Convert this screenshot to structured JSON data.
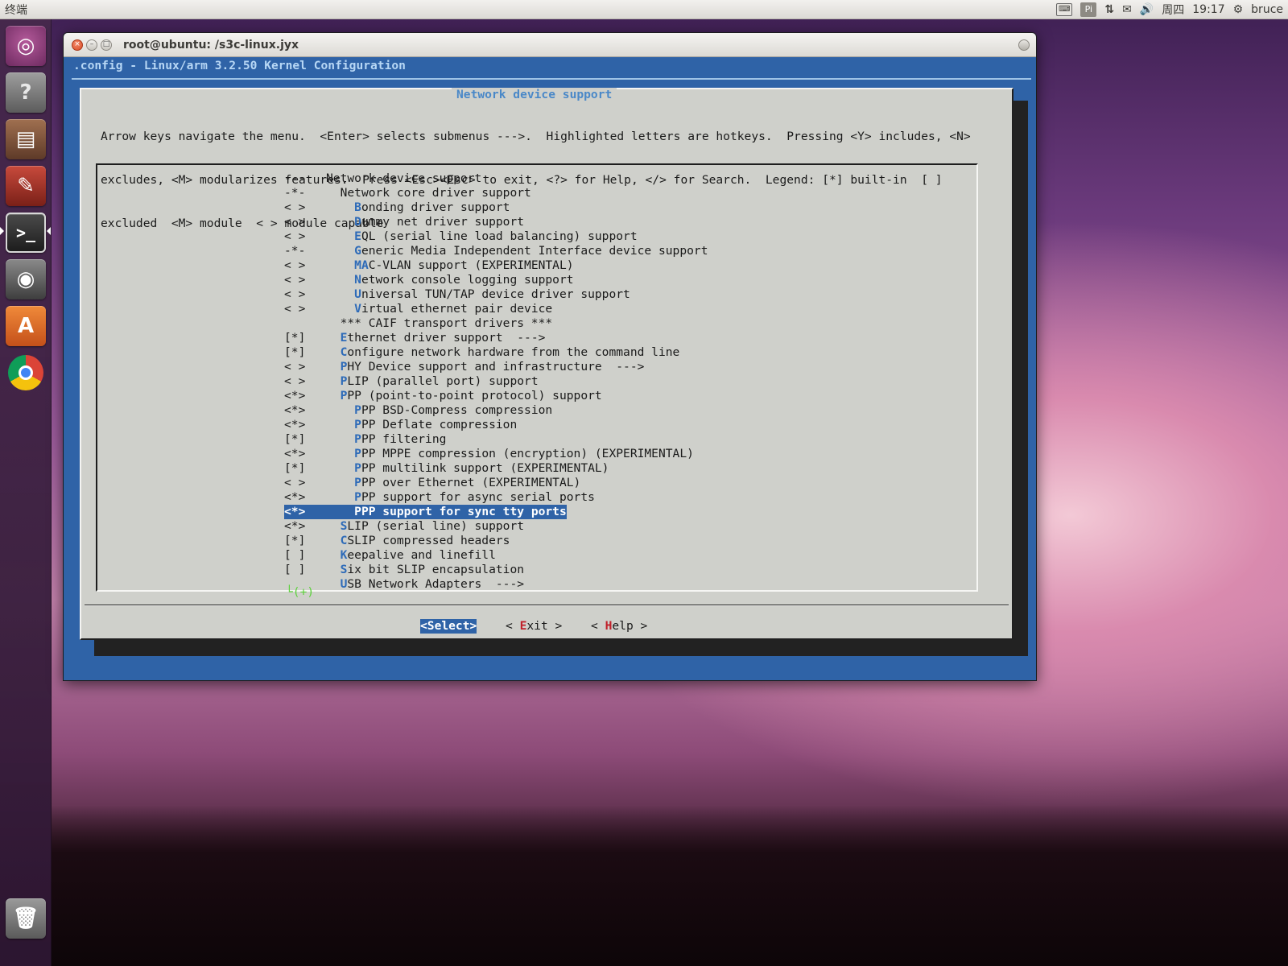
{
  "top_panel": {
    "app_name": "终端",
    "indicators": {
      "keyboard_icon": "keyboard-icon",
      "input_method": "Pi",
      "network_icon": "network-arrows-icon",
      "mail_icon": "mail-icon",
      "volume_glyph": "🔊)",
      "day": "周四",
      "time": "19:17",
      "user": "bruce"
    }
  },
  "launcher": {
    "items": [
      "ubuntu-dash",
      "help",
      "file-manager",
      "system-settings",
      "terminal",
      "camera",
      "software-center",
      "chrome",
      "trash"
    ]
  },
  "window": {
    "title": "root@ubuntu: /s3c-linux.jyx",
    "kconfig_title": ".config - Linux/arm 3.2.50 Kernel Configuration",
    "dialog": {
      "title": "Network device support",
      "help_lines": [
        "Arrow keys navigate the menu.  <Enter> selects submenus --->.  Highlighted letters are hotkeys.  Pressing <Y> includes, <N>",
        "excludes, <M> modularizes features.  Press <Esc><Esc> to exit, <?> for Help, </> for Search.  Legend: [*] built-in  [ ]",
        "excluded  <M> module  < > module capable"
      ],
      "menu": [
        {
          "state": "---",
          "indent": "",
          "hotkey": "",
          "rest": "Network device support"
        },
        {
          "state": "-*-",
          "indent": "  ",
          "hotkey": "N",
          "rest": "etwork core driver support",
          "hk_offset": 1
        },
        {
          "state": "< >",
          "indent": "    ",
          "hotkey": "B",
          "rest": "onding driver support"
        },
        {
          "state": "< >",
          "indent": "    ",
          "hotkey": "D",
          "rest": "ummy net driver support"
        },
        {
          "state": "< >",
          "indent": "    ",
          "hotkey": "E",
          "rest": "QL (serial line load balancing) support"
        },
        {
          "state": "-*-",
          "indent": "    ",
          "hotkey": "G",
          "rest": "eneric Media Independent Interface device support"
        },
        {
          "state": "< >",
          "indent": "    ",
          "hotkey": "MA",
          "rest": "C-VLAN support (EXPERIMENTAL)"
        },
        {
          "state": "< >",
          "indent": "    ",
          "hotkey": "N",
          "rest": "etwork console logging support"
        },
        {
          "state": "< >",
          "indent": "    ",
          "hotkey": "U",
          "rest": "niversal TUN/TAP device driver support"
        },
        {
          "state": "< >",
          "indent": "    ",
          "hotkey": "V",
          "rest": "irtual ethernet pair device"
        },
        {
          "state": "   ",
          "indent": "  ",
          "hotkey": "",
          "rest": "*** CAIF transport drivers ***"
        },
        {
          "state": "[*]",
          "indent": "  ",
          "hotkey": "E",
          "rest": "thernet driver support  --->"
        },
        {
          "state": "[*]",
          "indent": "  ",
          "hotkey": "C",
          "rest": "onfigure network hardware from the command line"
        },
        {
          "state": "< >",
          "indent": "  ",
          "hotkey": "P",
          "rest": "HY Device support and infrastructure  --->"
        },
        {
          "state": "< >",
          "indent": "  ",
          "hotkey": "P",
          "rest": "LIP (parallel port) support"
        },
        {
          "state": "<*>",
          "indent": "  ",
          "hotkey": "P",
          "rest": "PP (point-to-point protocol) support"
        },
        {
          "state": "<*>",
          "indent": "    ",
          "hotkey": "P",
          "rest": "PP BSD-Compress compression"
        },
        {
          "state": "<*>",
          "indent": "    ",
          "hotkey": "P",
          "rest": "PP Deflate compression"
        },
        {
          "state": "[*]",
          "indent": "    ",
          "hotkey": "P",
          "rest": "PP filtering"
        },
        {
          "state": "<*>",
          "indent": "    ",
          "hotkey": "P",
          "rest": "PP MPPE compression (encryption) (EXPERIMENTAL)"
        },
        {
          "state": "[*]",
          "indent": "    ",
          "hotkey": "P",
          "rest": "PP multilink support (EXPERIMENTAL)"
        },
        {
          "state": "< >",
          "indent": "    ",
          "hotkey": "P",
          "rest": "PP over Ethernet (EXPERIMENTAL)"
        },
        {
          "state": "<*>",
          "indent": "    ",
          "hotkey": "P",
          "rest": "PP support for async serial ports"
        },
        {
          "state": "<*>",
          "indent": "    ",
          "hotkey": "P",
          "rest": "PP support for sync tty ports",
          "selected": true
        },
        {
          "state": "<*>",
          "indent": "  ",
          "hotkey": "S",
          "rest": "LIP (serial line) support"
        },
        {
          "state": "[*]",
          "indent": "  ",
          "hotkey": "C",
          "rest": "SLIP compressed headers"
        },
        {
          "state": "[ ]",
          "indent": "  ",
          "hotkey": "K",
          "rest": "eepalive and linefill"
        },
        {
          "state": "[ ]",
          "indent": "  ",
          "hotkey": "S",
          "rest": "ix bit SLIP encapsulation"
        },
        {
          "state": "   ",
          "indent": "  ",
          "hotkey": "U",
          "rest": "SB Network Adapters  --->"
        }
      ],
      "more_indicator": "└(+)",
      "buttons": {
        "select": "<Select>",
        "exit_pre": "< ",
        "exit_hot": "E",
        "exit_rest": "xit >",
        "help_pre": "< ",
        "help_hot": "H",
        "help_rest": "elp >"
      }
    }
  },
  "colors": {
    "terminal_bg": "#2f63a7",
    "dialog_bg": "#cfd0cb",
    "hotkey": "#2e6bb8",
    "button_hotkey": "#c0202a",
    "more_indicator": "#5bd13a"
  }
}
